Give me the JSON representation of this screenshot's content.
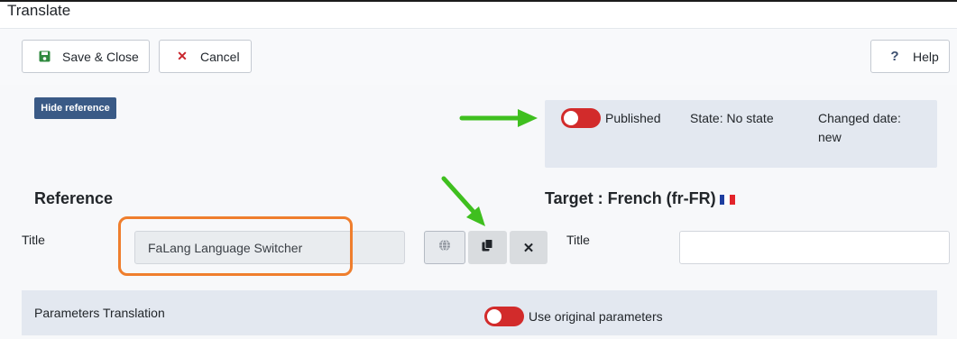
{
  "header": {
    "title": "Translate"
  },
  "toolbar": {
    "save_close_label": "Save & Close",
    "cancel_label": "Cancel",
    "help_label": "Help",
    "help_glyph": "?",
    "cancel_glyph": "✕"
  },
  "hide_reference_label": "Hide reference",
  "status": {
    "published_label": "Published",
    "published_state": "off",
    "state_text": "State: No state",
    "changed_date_label": "Changed date:",
    "changed_date_value": "new"
  },
  "reference": {
    "heading": "Reference",
    "title_label": "Title",
    "title_value": "FaLang Language Switcher"
  },
  "target": {
    "heading": "Target : French (fr-FR)",
    "title_label": "Title",
    "title_value": ""
  },
  "actions": {
    "clear_glyph": "✕"
  },
  "parameters": {
    "label": "Parameters Translation",
    "use_original_label": "Use original parameters",
    "use_original_state": "off"
  },
  "icons": [
    "save-icon",
    "cancel-icon",
    "help-icon",
    "globe-icon",
    "copy-icon",
    "clear-icon",
    "french-flag-icon"
  ],
  "colors": {
    "toggle_off": "#d22b2b",
    "hide_reference_bg": "#3a5a86",
    "annotation_arrow": "#3fbf1f",
    "annotation_highlight": "#ef7e2d"
  }
}
